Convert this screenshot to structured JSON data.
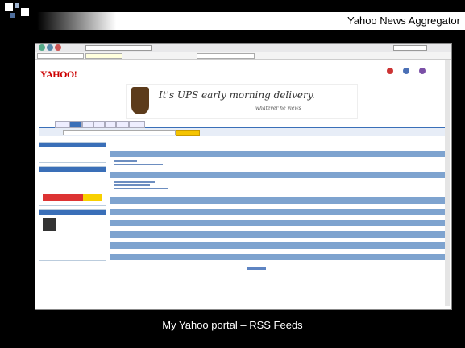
{
  "slide": {
    "title": "Yahoo News Aggregator",
    "caption": "My Yahoo portal – RSS Feeds"
  },
  "screenshot": {
    "logo_text": "YAHOO!",
    "ad_text": "It's UPS early morning delivery.",
    "ad_subtext": "whatever he views"
  },
  "colors": {
    "header_blue": "#3a6fb8",
    "feed_blue": "#7ea3cf",
    "yahoo_red": "#cc0000",
    "search_yellow": "#f5c400",
    "ups_brown": "#5c3b1b"
  }
}
